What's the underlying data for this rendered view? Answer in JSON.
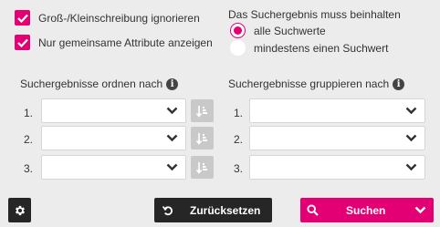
{
  "options": {
    "ignore_case_label": "Groß-/Kleinschreibung ignorieren",
    "common_attrs_label": "Nur gemeinsame Attribute anzeigen"
  },
  "result_must": {
    "title": "Das Suchergebnis muss beinhalten",
    "all_label": "alle Suchwerte",
    "any_label": "mindestens einen Suchwert"
  },
  "sort": {
    "heading": "Suchergebnisse ordnen nach",
    "rows": [
      {
        "num": "1."
      },
      {
        "num": "2."
      },
      {
        "num": "3."
      }
    ]
  },
  "group": {
    "heading": "Suchergebnisse gruppieren nach",
    "rows": [
      {
        "num": "1."
      },
      {
        "num": "2."
      },
      {
        "num": "3."
      }
    ]
  },
  "footer": {
    "reset_label": "Zurücksetzen",
    "search_label": "Suchen"
  },
  "colors": {
    "accent": "#e20074",
    "dark": "#262626"
  },
  "icons": {
    "checkbox": "checkmark-icon",
    "info": "info-icon",
    "select": "chevron-down-icon",
    "sort": "sort-direction-icon",
    "settings": "gear-icon",
    "reset": "undo-icon",
    "search": "search-icon"
  }
}
